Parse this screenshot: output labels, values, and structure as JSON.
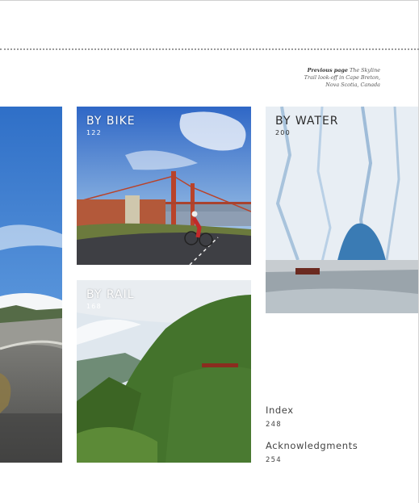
{
  "caption": {
    "bold": "Previous page",
    "line1_rest": " The Skyline",
    "line2": "Trail look-off in Cape Breton,",
    "line3": "Nova Scotia, Canada"
  },
  "sections": [
    {
      "title": "BY BIKE",
      "page": "122"
    },
    {
      "title": "BY WATER",
      "page": "200"
    },
    {
      "title": "BY RAIL",
      "page": "168"
    }
  ],
  "toc": [
    {
      "title": "Index",
      "page": "248"
    },
    {
      "title": "Acknowledgments",
      "page": "254"
    }
  ],
  "colors": {
    "sky": "#3f7bd0",
    "bridge": "#c0452a",
    "glacier": "#dfe9f2",
    "forest": "#3f6e2c"
  }
}
